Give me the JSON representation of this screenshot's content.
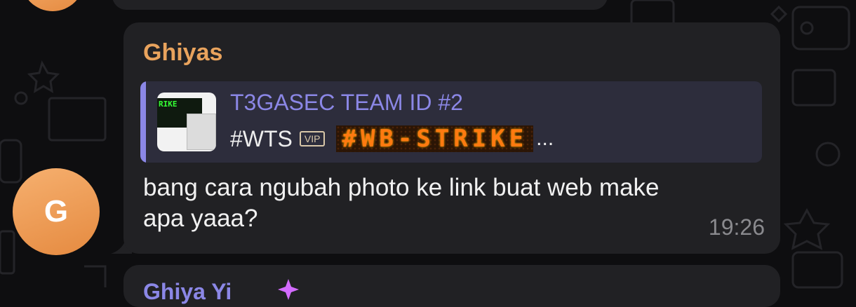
{
  "colors": {
    "background": "#0e0e10",
    "bubble": "#212124",
    "sender_name": "#e9a35d",
    "reply_accent": "#8b87e6",
    "avatar": "#ee9b52",
    "timestamp": "#8a8a8e"
  },
  "message": {
    "sender": "Ghiyas",
    "avatar_letter": "G",
    "reply": {
      "title": "T3GASEC TEAM ID #2",
      "tag": "#WTS",
      "vip_badge": "VIP",
      "banner_text": "#WB-STRIKE",
      "ellipsis": "...",
      "thumb_text": "RIKE"
    },
    "text": "bang cara ngubah photo ke link buat web make apa yaaa?",
    "time": "19:26"
  },
  "next_message": {
    "sender": "Ghiya Yi"
  }
}
